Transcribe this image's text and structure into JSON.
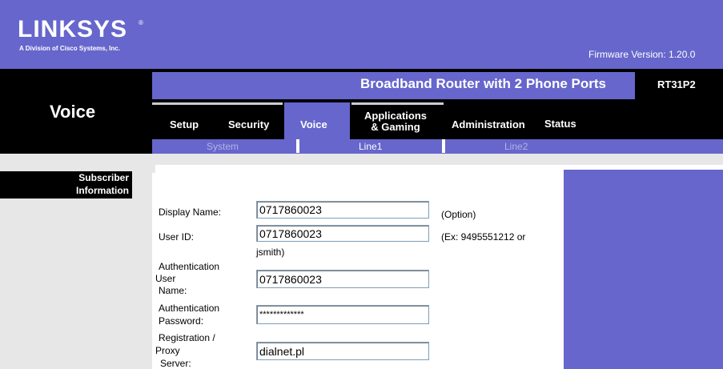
{
  "header": {
    "logo_text": "LINKSYS",
    "logo_reg": "®",
    "logo_subtitle": "A Division of Cisco Systems, Inc.",
    "firmware": "Firmware Version: 1.20.0"
  },
  "product": {
    "name": "Broadband Router with 2 Phone Ports",
    "model": "RT31P2"
  },
  "page_title": "Voice",
  "tabs": [
    {
      "label": "Setup"
    },
    {
      "label": "Security"
    },
    {
      "label": "Voice",
      "active": true
    },
    {
      "label_line1": "Applications",
      "label_line2": "& Gaming"
    },
    {
      "label": "Administration"
    },
    {
      "label": "Status"
    }
  ],
  "subtabs": [
    {
      "label": "System"
    },
    {
      "label": "Line1",
      "active": true
    },
    {
      "label": "Line2"
    }
  ],
  "section": {
    "line1": "Subscriber",
    "line2": "Information"
  },
  "form": {
    "display_name": {
      "label": "Display Name:",
      "value": "0717860023",
      "note": "(Option)"
    },
    "user_id": {
      "label": "User ID:",
      "value": "0717860023",
      "note": "(Ex: 9495551212 or",
      "note_cont": "jsmith)"
    },
    "auth_user": {
      "label_1": "Authentication",
      "label_2": "User",
      "label_3": "Name:",
      "value": "0717860023"
    },
    "auth_pass": {
      "label_1": "Authentication",
      "label_2": "Password:",
      "value": "*************"
    },
    "proxy": {
      "label_1": "Registration /",
      "label_2": "Proxy",
      "label_3": "Server:",
      "value": "dialnet.pl"
    }
  },
  "colors": {
    "brand_purple": "#6666cc",
    "black": "#000000",
    "gray": "#e7e7e7"
  }
}
